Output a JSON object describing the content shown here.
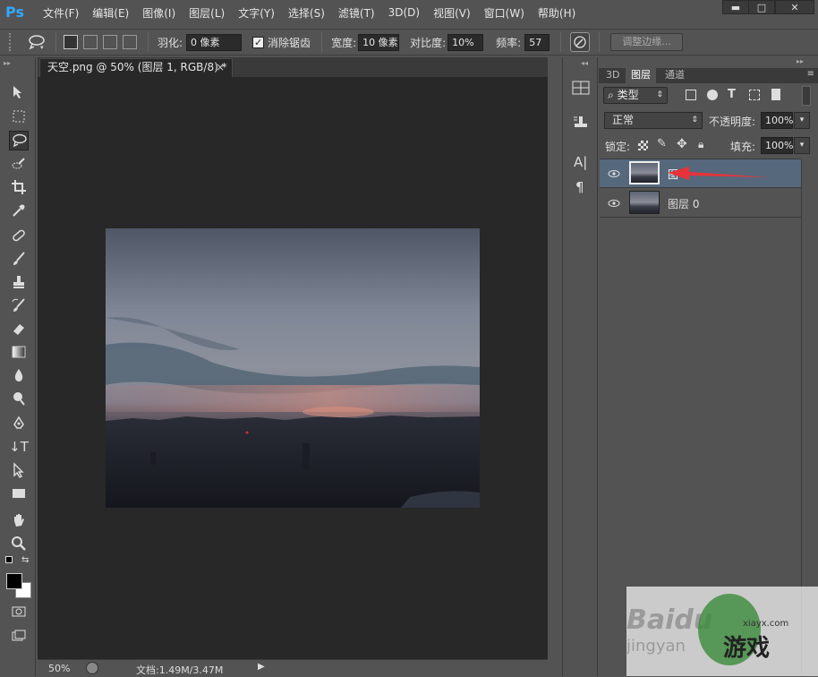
{
  "app": {
    "logo_text": "Ps"
  },
  "menu": [
    "文件(F)",
    "编辑(E)",
    "图像(I)",
    "图层(L)",
    "文字(Y)",
    "选择(S)",
    "滤镜(T)",
    "3D(D)",
    "视图(V)",
    "窗口(W)",
    "帮助(H)"
  ],
  "window_controls": {
    "minimize": "▬",
    "maximize": "□",
    "close": "✕"
  },
  "options": {
    "feather_label": "羽化:",
    "feather_value": "0 像素",
    "antialias_label": "消除锯齿",
    "antialias_checked": true,
    "width_label": "宽度:",
    "width_value": "10 像素",
    "contrast_label": "对比度:",
    "contrast_value": "10%",
    "frequency_label": "频率:",
    "frequency_value": "57",
    "refine_edge_label": "调整边缘..."
  },
  "document": {
    "tab_title": "天空.png @ 50% (图层 1, RGB/8) *",
    "tab_close": "×",
    "zoom": "50%",
    "doc_info": "文档:1.49M/3.47M"
  },
  "panel": {
    "tabs": [
      "3D",
      "图层",
      "通道"
    ],
    "active_tab": "图层",
    "filter_kind": "类型",
    "blend_mode": "正常",
    "opacity_label": "不透明度:",
    "opacity_value": "100%",
    "lock_label": "锁定:",
    "fill_label": "填充:",
    "fill_value": "100%",
    "layers": [
      {
        "name": "图",
        "selected": true
      },
      {
        "name": "图层 0",
        "selected": false
      }
    ]
  },
  "watermark": {
    "left_text": "Baidu",
    "bottom_text": "jingyan",
    "right_text": "游戏",
    "site": "xiayx.com"
  },
  "colors": {
    "accent": "#31a8ff",
    "selected_layer": "#56687c",
    "arrow": "#e8333a"
  }
}
